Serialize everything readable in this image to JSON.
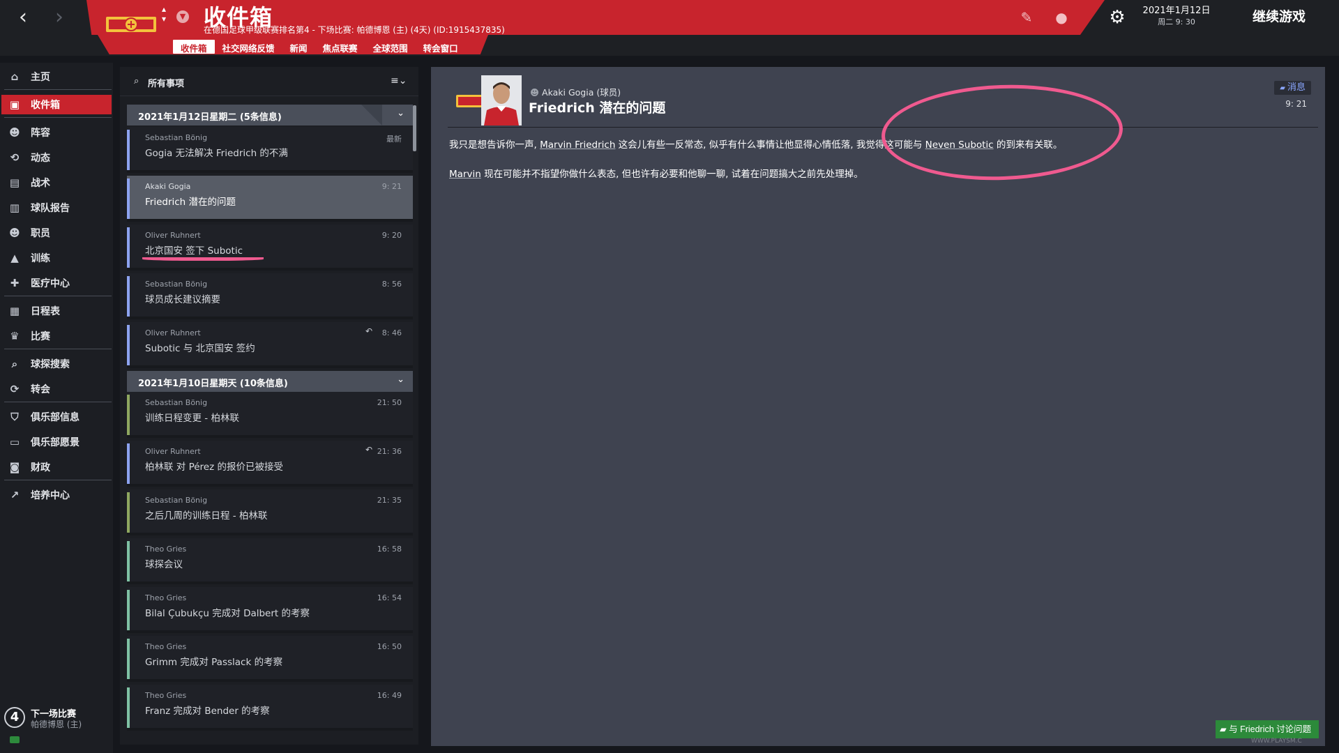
{
  "header": {
    "title": "收件箱",
    "subtitle": "在德国足球甲级联赛排名第4 - 下场比赛: 帕德博恩 (主) (4天) (ID:1915437835)",
    "tabs": [
      "收件箱",
      "社交网络反馈",
      "新闻",
      "焦点联赛",
      "全球范围",
      "转会窗口"
    ],
    "active_tab": "收件箱",
    "date": "2021年1月12日",
    "time": "周二 9: 30",
    "continue_label": "继续游戏",
    "icons": [
      "back-arrow-icon",
      "forward-arrow-icon",
      "club-crest-icon",
      "pencil-icon",
      "club-badge-icon",
      "gear-icon"
    ],
    "accent_color": "#c8242d"
  },
  "sidebar": {
    "items": [
      {
        "label": "主页",
        "icon": "home-icon"
      },
      {
        "label": "收件箱",
        "icon": "inbox-icon"
      },
      {
        "label": "阵容",
        "icon": "squad-icon"
      },
      {
        "label": "动态",
        "icon": "dynamics-icon"
      },
      {
        "label": "战术",
        "icon": "tactics-icon"
      },
      {
        "label": "球队报告",
        "icon": "report-icon"
      },
      {
        "label": "职员",
        "icon": "staff-icon"
      },
      {
        "label": "训练",
        "icon": "training-icon"
      },
      {
        "label": "医疗中心",
        "icon": "medical-icon"
      },
      {
        "label": "日程表",
        "icon": "calendar-icon"
      },
      {
        "label": "比赛",
        "icon": "trophy-icon"
      },
      {
        "label": "球探搜索",
        "icon": "search-icon"
      },
      {
        "label": "转会",
        "icon": "transfer-icon"
      },
      {
        "label": "俱乐部信息",
        "icon": "shield-icon"
      },
      {
        "label": "俱乐部愿景",
        "icon": "vision-icon"
      },
      {
        "label": "财政",
        "icon": "money-icon"
      },
      {
        "label": "培养中心",
        "icon": "development-icon"
      }
    ],
    "next_match": {
      "number": "4",
      "label": "下一场比赛",
      "opponent": "帕德博恩 (主)"
    }
  },
  "list": {
    "search_label": "所有事项",
    "groups": [
      {
        "title": "2021年1月12日星期二 (5条信息)",
        "messages": [
          {
            "sender": "Sebastian Bönig",
            "subject": "Gogia 无法解决 Friedrich 的不满",
            "time": "最新",
            "accent": "#8da3f0"
          },
          {
            "sender": "Akaki Gogia",
            "subject": "Friedrich 潜在的问题",
            "time": "9: 21",
            "accent": "#8da3f0"
          },
          {
            "sender": "Oliver Ruhnert",
            "subject": "北京国安 签下 Subotic",
            "time": "9: 20",
            "accent": "#8da3f0"
          },
          {
            "sender": "Sebastian Bönig",
            "subject": "球员成长建议摘要",
            "time": "8: 56",
            "accent": "#8da3f0"
          },
          {
            "sender": "Oliver Ruhnert",
            "subject": "Subotic 与 北京国安 签约",
            "time": "8: 46",
            "accent": "#8da3f0",
            "replied": true
          }
        ]
      },
      {
        "title": "2021年1月10日星期天 (10条信息)",
        "messages": [
          {
            "sender": "Sebastian Bönig",
            "subject": "训练日程变更 - 柏林联",
            "time": "21: 50",
            "accent": "#8fa860"
          },
          {
            "sender": "Oliver Ruhnert",
            "subject": "柏林联 对 Pérez 的报价已被接受",
            "time": "21: 36",
            "accent": "#8da3f0",
            "replied": true
          },
          {
            "sender": "Sebastian Bönig",
            "subject": "之后几周的训练日程 - 柏林联",
            "time": "21: 35",
            "accent": "#8fa860"
          },
          {
            "sender": "Theo Gries",
            "subject": "球探会议",
            "time": "16: 58",
            "accent": "#7fc2a4"
          },
          {
            "sender": "Theo Gries",
            "subject": "Bilal Çubukçu 完成对 Dalbert 的考察",
            "time": "16: 54",
            "accent": "#7fc2a4"
          },
          {
            "sender": "Theo Gries",
            "subject": "Grimm 完成对 Passlack 的考察",
            "time": "16: 50",
            "accent": "#7fc2a4"
          },
          {
            "sender": "Theo Gries",
            "subject": "Franz 完成对 Bender 的考察",
            "time": "16: 49",
            "accent": "#7fc2a4"
          }
        ]
      }
    ]
  },
  "detail": {
    "from": "Akaki Gogia",
    "from_role": "(球员)",
    "title": "Friedrich 潜在的问题",
    "type_label": "消息",
    "time": "9: 21",
    "body": {
      "p1_a": "我只是想告诉你一声, ",
      "p1_name1": "Marvin Friedrich",
      "p1_b": " 这会儿有些一反常态, 似乎有什么事情让他显得心情低落, 我觉得这可能与 ",
      "p1_name2": "Neven Subotic",
      "p1_c": " 的到来有关联。",
      "p2_name": "Marvin",
      "p2_text": " 现在可能并不指望你做什么表态, 但也许有必要和他聊一聊, 试着在问题搞大之前先处理掉。"
    },
    "discuss_label": "与 Friedrich 讨论问题"
  },
  "watermark": "WWW.PLAYSM.C"
}
